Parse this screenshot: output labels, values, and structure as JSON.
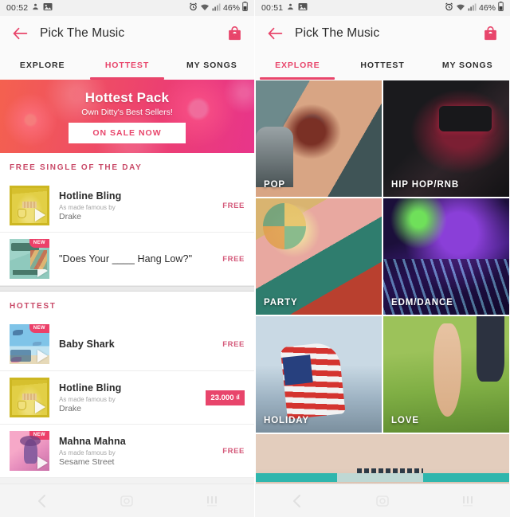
{
  "left_phone": {
    "status_bar": {
      "time": "00:52",
      "battery": "46%",
      "icons": [
        "location-icon",
        "gallery-icon",
        "alarm-icon",
        "wifi-icon",
        "signal-icon",
        "battery-icon"
      ]
    },
    "app_bar": {
      "back_icon": "back-arrow-icon",
      "title": "Pick The Music",
      "action_icon": "shopping-bag-icon"
    },
    "tabs": [
      {
        "label": "EXPLORE",
        "active": false
      },
      {
        "label": "HOTTEST",
        "active": true
      },
      {
        "label": "MY SONGS",
        "active": false
      }
    ],
    "banner": {
      "title": "Hottest Pack",
      "subtitle": "Own Ditty's Best Sellers!",
      "button": "ON SALE NOW"
    },
    "sections": [
      {
        "heading": "FREE SINGLE OF THE DAY",
        "items": [
          {
            "title": "Hotline Bling",
            "famous_by": "As made famous by",
            "artist": "Drake",
            "price": "FREE",
            "price_style": "text",
            "badge": "",
            "art": "th-bling"
          },
          {
            "title": "\"Does Your ____ Hang Low?\"",
            "famous_by": "",
            "artist": "",
            "price": "FREE",
            "price_style": "text",
            "badge": "NEW",
            "art": "th-does"
          }
        ]
      },
      {
        "heading": "HOTTEST",
        "items": [
          {
            "title": "Baby Shark",
            "famous_by": "",
            "artist": "",
            "price": "FREE",
            "price_style": "text",
            "badge": "NEW",
            "art": "th-shark"
          },
          {
            "title": "Hotline Bling",
            "famous_by": "As made famous by",
            "artist": "Drake",
            "price": "23.000 ₫",
            "price_style": "badge",
            "badge": "",
            "art": "th-bling"
          },
          {
            "title": "Mahna Mahna",
            "famous_by": "As made famous by",
            "artist": "Sesame Street",
            "price": "FREE",
            "price_style": "text",
            "badge": "NEW",
            "art": "th-mahna"
          }
        ]
      }
    ],
    "nav_bar": [
      "back-nav-icon",
      "home-nav-icon",
      "recents-nav-icon"
    ]
  },
  "right_phone": {
    "status_bar": {
      "time": "00:51",
      "battery": "46%",
      "icons": [
        "location-icon",
        "gallery-icon",
        "alarm-icon",
        "wifi-icon",
        "signal-icon",
        "battery-icon"
      ]
    },
    "app_bar": {
      "back_icon": "back-arrow-icon",
      "title": "Pick The Music",
      "action_icon": "shopping-bag-icon"
    },
    "tabs": [
      {
        "label": "EXPLORE",
        "active": true
      },
      {
        "label": "HOTTEST",
        "active": false
      },
      {
        "label": "MY SONGS",
        "active": false
      }
    ],
    "categories": [
      {
        "label": "POP",
        "art": "c-pop",
        "wide": false
      },
      {
        "label": "HIP HOP/RNB",
        "art": "c-hip",
        "wide": false
      },
      {
        "label": "PARTY",
        "art": "c-party",
        "wide": false
      },
      {
        "label": "EDM/DANCE",
        "art": "c-edm",
        "wide": false
      },
      {
        "label": "HOLIDAY",
        "art": "c-holiday",
        "wide": false
      },
      {
        "label": "LOVE",
        "art": "c-love",
        "wide": false
      },
      {
        "label": "",
        "art": "c-beach",
        "wide": true
      }
    ],
    "nav_bar": [
      "back-nav-icon",
      "home-nav-icon",
      "recents-nav-icon"
    ]
  },
  "theme": {
    "accent": "#e8456b",
    "section_heading": "#c94a68",
    "badge_bg": "#e8456b"
  }
}
